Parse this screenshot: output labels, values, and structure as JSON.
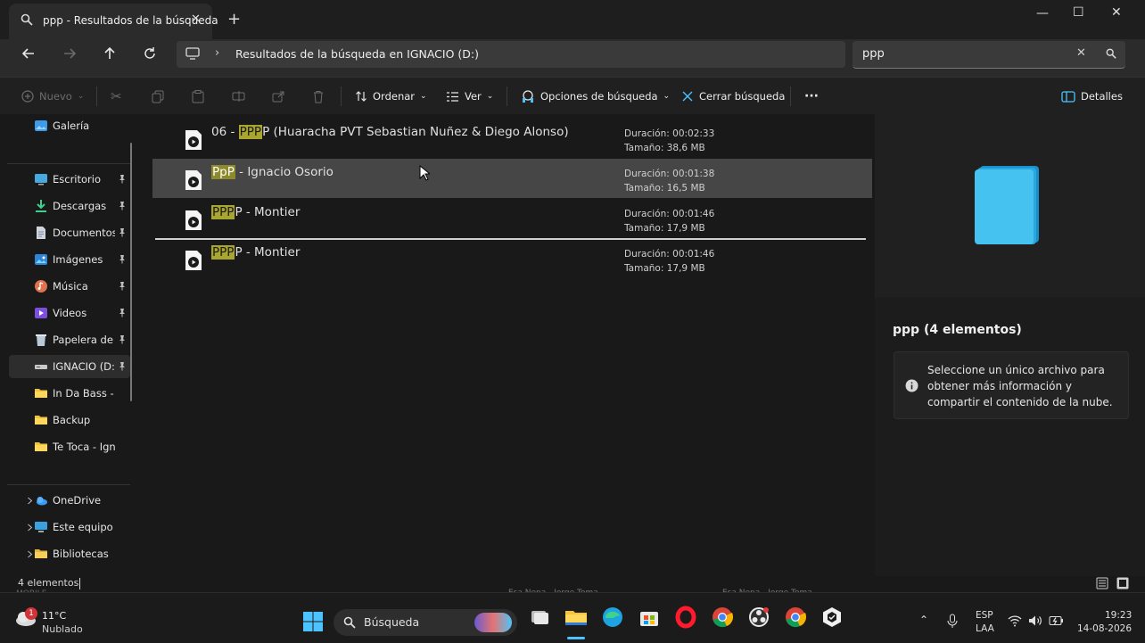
{
  "window": {
    "tab_title": "ppp - Resultados de la búsqueda",
    "min_label": "—",
    "max_label": "☐",
    "close_label": "✕"
  },
  "address": {
    "path": "Resultados de la búsqueda en IGNACIO (D:)",
    "search_value": "ppp"
  },
  "toolbar": {
    "new_label": "Nuevo",
    "sort_label": "Ordenar",
    "view_label": "Ver",
    "search_options_label": "Opciones de búsqueda",
    "close_search_label": "Cerrar búsqueda",
    "more_label": "···",
    "details_label": "Detalles"
  },
  "sidebar": {
    "items": [
      {
        "label": "Galería",
        "icon": "gallery-icon"
      },
      {
        "label": "Escritorio",
        "icon": "desktop-icon"
      },
      {
        "label": "Descargas",
        "icon": "download-icon"
      },
      {
        "label": "Documentos",
        "icon": "documents-icon"
      },
      {
        "label": "Imágenes",
        "icon": "pictures-icon"
      },
      {
        "label": "Música",
        "icon": "music-icon"
      },
      {
        "label": "Videos",
        "icon": "videos-icon"
      },
      {
        "label": "Papelera de r",
        "icon": "recycle-bin-icon"
      },
      {
        "label": "IGNACIO (D:)",
        "icon": "drive-icon"
      },
      {
        "label": "In Da Bass - Anc",
        "icon": "folder-icon"
      },
      {
        "label": "Backup",
        "icon": "folder-icon"
      },
      {
        "label": "Te Toca - Ignaci",
        "icon": "folder-icon"
      },
      {
        "label": "OneDrive",
        "icon": "onedrive-icon"
      },
      {
        "label": "Este equipo",
        "icon": "this-pc-icon"
      },
      {
        "label": "Bibliotecas",
        "icon": "libraries-icon"
      }
    ]
  },
  "files": [
    {
      "pre": "06 - ",
      "match": "PPP",
      "post": "P (Huaracha PVT Sebastian Nuñez & Diego Alonso)",
      "duration": "Duración: 00:02:33",
      "size": "Tamaño: 38,6 MB"
    },
    {
      "pre": "",
      "match": "PpP",
      "post": " - Ignacio Osorio",
      "duration": "Duración: 00:01:38",
      "size": "Tamaño: 16,5 MB"
    },
    {
      "pre": "",
      "match": "PPP",
      "post": "P - Montier",
      "duration": "Duración: 00:01:46",
      "size": "Tamaño: 17,9 MB"
    },
    {
      "pre": "",
      "match": "PPP",
      "post": "P - Montier",
      "duration": "Duración: 00:01:46",
      "size": "Tamaño: 17,9 MB"
    }
  ],
  "details": {
    "heading": "ppp (4 elementos)",
    "info": "Seleccione un único archivo para obtener más información y compartir el contenido de la nube."
  },
  "status": {
    "count": "4 elementos"
  },
  "background_strip": {
    "left_text": "MOBILE",
    "song1": "Esa Nena - Jorge Toma",
    "song2": "Esa Nena - Jorge Toma"
  },
  "taskbar": {
    "weather_temp": "11°C",
    "weather_desc": "Nublado",
    "weather_badge": "1",
    "search_label": "Búsqueda",
    "lang_top": "ESP",
    "lang_bottom": "LAA",
    "time": "19:23",
    "date": "14-08-2026"
  },
  "colors": {
    "highlight": "#a9a630",
    "selected_row": "#464646",
    "accent_blue": "#4cc2ff"
  }
}
